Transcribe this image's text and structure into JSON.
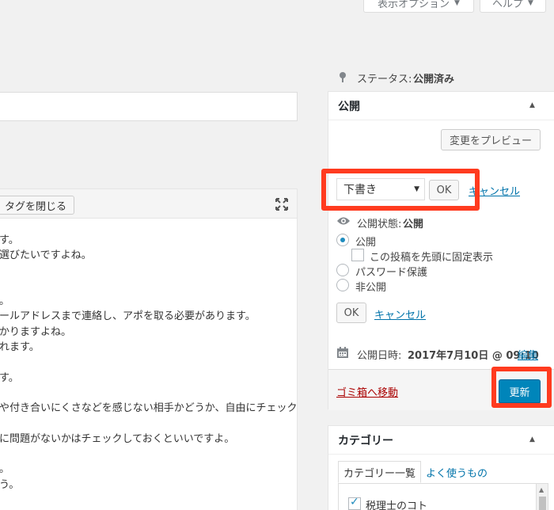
{
  "top_bar": {
    "screen_options_label": "表示オプション",
    "help_label": "ヘルプ"
  },
  "editor": {
    "close_tags_label": "タグを閉じる",
    "lines": [
      "す。",
      "選びたいですよね。",
      "",
      "",
      "。",
      "ールアドレスまで連絡し、アポを取る必要があります。",
      "かりますよね。",
      "れます。",
      "",
      "す。",
      "",
      "や付き合いにくさなどを感じない相手かどうか、自由にチェック",
      "",
      "に問題がないかはチェックしておくといいですよ。",
      "",
      "。",
      "う。"
    ]
  },
  "publish": {
    "title": "公開",
    "preview_label": "変更をプレビュー",
    "status_label": "ステータス:",
    "status_value": "公開済み",
    "status_select_value": "下書き",
    "ok_label": "OK",
    "cancel_label": "キャンセル",
    "visibility_label": "公開状態:",
    "visibility_value": "公開",
    "visibility_options": {
      "public": "公開",
      "sticky": "この投稿を先頭に固定表示",
      "password": "パスワード保護",
      "private": "非公開"
    },
    "ok2_label": "OK",
    "cancel2_label": "キャンセル",
    "date_label": "公開日時:",
    "date_value": "2017年7月10日 @ 09:10",
    "edit_label": "編集",
    "trash_label": "ゴミ箱へ移動",
    "update_label": "更新"
  },
  "category": {
    "title": "カテゴリー",
    "tab_all": "カテゴリー一覧",
    "tab_popular": "よく使うもの",
    "items": [
      "税理士のコト"
    ]
  },
  "colors": {
    "highlight": "#ff3b1f",
    "primary": "#0085ba",
    "link": "#0073aa",
    "trash": "#a00000"
  }
}
